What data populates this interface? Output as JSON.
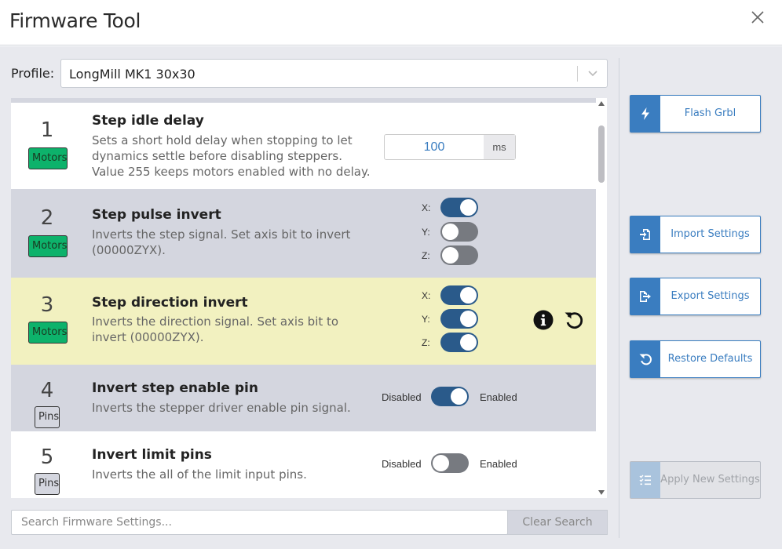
{
  "window": {
    "title": "Firmware Tool"
  },
  "profile": {
    "label": "Profile:",
    "value": "LongMill MK1 30x30"
  },
  "settings": [
    {
      "num": "1",
      "tag": "Motors",
      "title": "Step idle delay",
      "desc": "Sets a short hold delay when stopping to let dynamics settle before disabling steppers. Value 255 keeps motors enabled with no delay.",
      "value": "100",
      "unit": "ms"
    },
    {
      "num": "2",
      "tag": "Motors",
      "title": "Step pulse invert",
      "desc": "Inverts the step signal. Set axis bit to invert (00000ZYX).",
      "axes": [
        {
          "label": "X:",
          "on": true
        },
        {
          "label": "Y:",
          "on": false
        },
        {
          "label": "Z:",
          "on": false
        }
      ]
    },
    {
      "num": "3",
      "tag": "Motors",
      "title": "Step direction invert",
      "desc": "Inverts the direction signal. Set axis bit to invert (00000ZYX).",
      "axes": [
        {
          "label": "X:",
          "on": true
        },
        {
          "label": "Y:",
          "on": true
        },
        {
          "label": "Z:",
          "on": true
        }
      ]
    },
    {
      "num": "4",
      "tag": "Pins",
      "title": "Invert step enable pin",
      "desc": "Inverts the stepper driver enable pin signal.",
      "disabled_label": "Disabled",
      "enabled_label": "Enabled",
      "on": true
    },
    {
      "num": "5",
      "tag": "Pins",
      "title": "Invert limit pins",
      "desc": "Inverts the all of the limit input pins.",
      "disabled_label": "Disabled",
      "enabled_label": "Enabled",
      "on": false
    }
  ],
  "search": {
    "placeholder": "Search Firmware Settings...",
    "clear_label": "Clear Search"
  },
  "sidebar": {
    "flash": "Flash Grbl",
    "import": "Import Settings",
    "export": "Export Settings",
    "restore": "Restore Defaults",
    "apply": "Apply New Settings"
  },
  "colors": {
    "accent": "#3a7dc0",
    "motors_tag": "#0db26b",
    "toggle_on": "#2a5a8a",
    "modified_row": "#f2f1c0"
  }
}
